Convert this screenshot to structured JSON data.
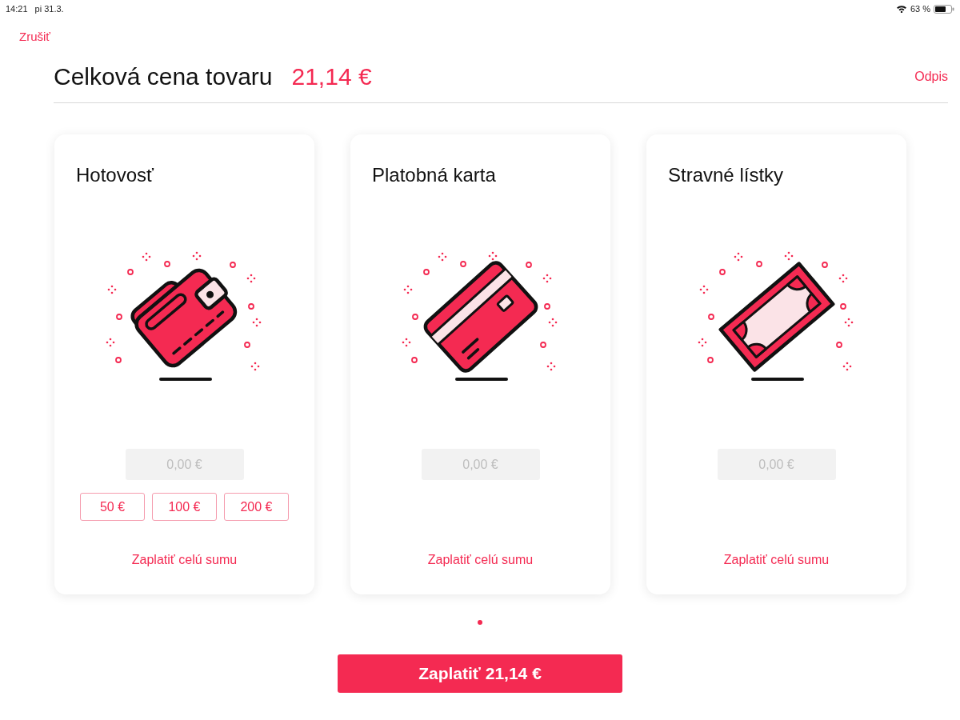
{
  "status_bar": {
    "time": "14:21",
    "date": "pi 31.3.",
    "battery": "63 %"
  },
  "nav": {
    "cancel": "Zrušiť"
  },
  "header": {
    "title": "Celková cena tovaru",
    "total": "21,14 €",
    "action": "Odpis"
  },
  "payment_methods": [
    {
      "kind": "cash",
      "title": "Hotovosť",
      "amount_field": {
        "placeholder": "0,00 €"
      },
      "quick_amounts": [
        "50 €",
        "100 €",
        "200 €"
      ],
      "pay_full": "Zaplatiť celú sumu"
    },
    {
      "kind": "card",
      "title": "Platobná karta",
      "amount_field": {
        "placeholder": "0,00 €"
      },
      "pay_full": "Zaplatiť celú sumu"
    },
    {
      "kind": "voucher",
      "title": "Stravné lístky",
      "amount_field": {
        "placeholder": "0,00 €"
      },
      "pay_full": "Zaplatiť celú sumu"
    }
  ],
  "pager": {
    "dots": [
      {
        "selected": true
      }
    ]
  },
  "pay_button": "Zaplatiť 21,14 €"
}
